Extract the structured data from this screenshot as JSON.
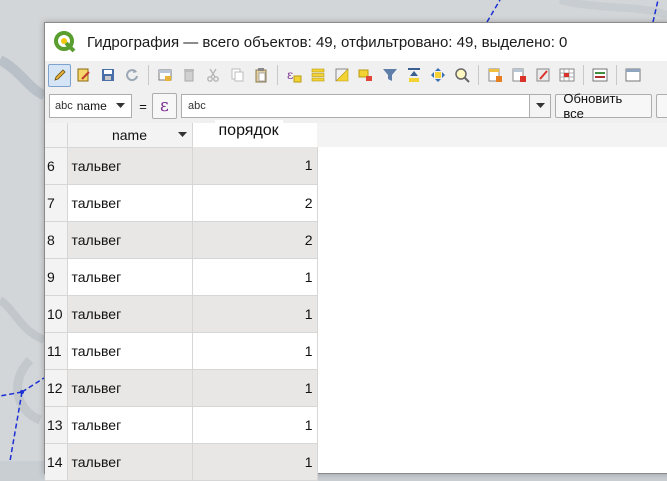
{
  "window": {
    "title": "Гидрография — всего объектов: 49, отфильтровано: 49, выделено: 0"
  },
  "toolbar": {
    "icons": [
      "toggle-editing-icon",
      "multi-edit-icon",
      "save-edits-icon",
      "reload-icon",
      "add-feature-icon",
      "delete-feature-icon",
      "cut-icon",
      "copy-icon",
      "paste-icon",
      "select-by-expression-icon",
      "select-all-icon",
      "invert-selection-icon",
      "deselect-all-icon",
      "filter-icon",
      "move-selection-top-icon",
      "pan-to-selected-icon",
      "zoom-to-selected-icon",
      "new-field-icon",
      "delete-field-icon",
      "field-calculator-icon",
      "conditional-format-icon",
      "dock-table-icon",
      "actions-icon"
    ]
  },
  "filter": {
    "field_type_label": "abc",
    "field_name": "name",
    "operator": "=",
    "expression_symbol": "ε",
    "value_type_label": "abc",
    "value": "",
    "update_button": "Обновить все"
  },
  "table": {
    "columns": [
      "name",
      "порядок"
    ],
    "rows": [
      {
        "num": "6",
        "name": "тальвег",
        "order": "1"
      },
      {
        "num": "7",
        "name": "тальвег",
        "order": "2"
      },
      {
        "num": "8",
        "name": "тальвег",
        "order": "2"
      },
      {
        "num": "9",
        "name": "тальвег",
        "order": "1"
      },
      {
        "num": "10",
        "name": "тальвег",
        "order": "1"
      },
      {
        "num": "11",
        "name": "тальвег",
        "order": "1"
      },
      {
        "num": "12",
        "name": "тальвег",
        "order": "1"
      },
      {
        "num": "13",
        "name": "тальвег",
        "order": "1"
      },
      {
        "num": "14",
        "name": "тальвег",
        "order": "1"
      }
    ]
  },
  "colors": {
    "accent_edit": "#7da2ce",
    "row_alt": "#e8e7e5",
    "map_line": "#1b2fd6"
  }
}
